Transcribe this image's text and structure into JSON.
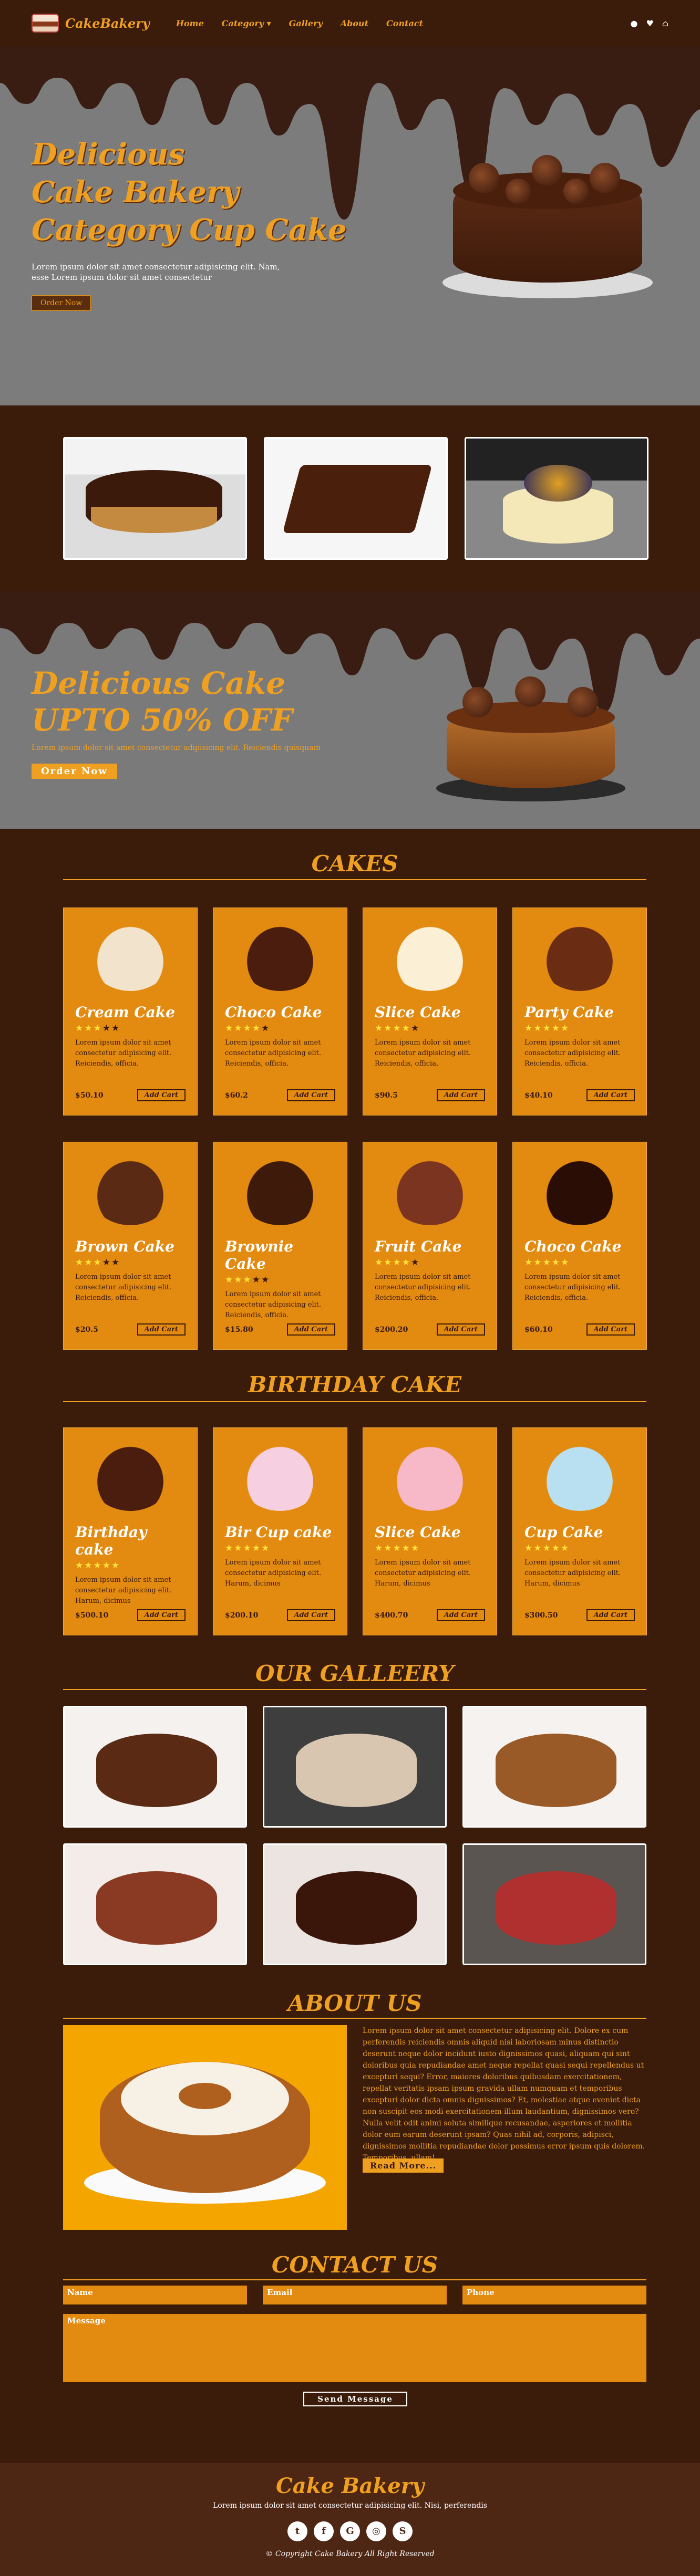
{
  "nav": {
    "logo": "CakeBakery",
    "items": [
      "Home",
      "Category",
      "Gallery",
      "About",
      "Contact"
    ],
    "category_caret": "▾",
    "icons": [
      "user-icon",
      "heart-icon",
      "cart-icon"
    ]
  },
  "hero": {
    "line1": "Delicious",
    "line2": "Cake Bakery",
    "line3": "Category Cup Cake",
    "sub": "Lorem ipsum dolor sit amet consectetur adipisicing elit. Nam, esse Lorem ipsum dolor sit amet consectetur",
    "button": "Order Now"
  },
  "promo": {
    "title": "Delicious Cake",
    "offer": "UPTO 50% OFF",
    "sub": "Lorem ipsum dolor sit amet consectetur adipisicing elit. Reiciendis quisquam",
    "button": "Order Now"
  },
  "cakes": {
    "title": "CAKES",
    "items": [
      {
        "name": "Cream Cake",
        "stars": 3,
        "desc": "Lorem ipsum dolor sit amet consectetur adipisicing elit. Reiciendis, officia.",
        "price": "$50.10",
        "color": "#f2e4cc"
      },
      {
        "name": "Choco Cake",
        "stars": 4,
        "desc": "Lorem ipsum dolor sit amet consectetur adipisicing elit. Reiciendis, officia.",
        "price": "$60.2",
        "color": "#4a1d0e"
      },
      {
        "name": "Slice Cake",
        "stars": 4,
        "desc": "Lorem ipsum dolor sit amet consectetur adipisicing elit. Reiciendis, officia.",
        "price": "$90.5",
        "color": "#fbefd6"
      },
      {
        "name": "Party Cake",
        "stars": 5,
        "desc": "Lorem ipsum dolor sit amet consectetur adipisicing elit. Reiciendis, officia.",
        "price": "$40.10",
        "color": "#6a2c12"
      },
      {
        "name": "Brown Cake",
        "stars": 3,
        "desc": "Lorem ipsum dolor sit amet consectetur adipisicing elit. Reiciendis, officia.",
        "price": "$20.5",
        "color": "#5a2a14"
      },
      {
        "name": "Brownie Cake",
        "stars": 3,
        "desc": "Lorem ipsum dolor sit amet consectetur adipisicing elit. Reiciendis, officia.",
        "price": "$15.80",
        "color": "#3e1a0a"
      },
      {
        "name": "Fruit Cake",
        "stars": 4,
        "desc": "Lorem ipsum dolor sit amet consectetur adipisicing elit. Reiciendis, officia.",
        "price": "$200.20",
        "color": "#7a3420"
      },
      {
        "name": "Choco Cake",
        "stars": 5,
        "desc": "Lorem ipsum dolor sit amet consectetur adipisicing elit. Reiciendis, officia.",
        "price": "$60.10",
        "color": "#2a0e06"
      }
    ],
    "add_cart": "Add Cart"
  },
  "birthday": {
    "title": "BIRTHDAY CAKE",
    "items": [
      {
        "name": "Birthday cake",
        "stars": 5,
        "desc": "Lorem ipsum dolor sit amet consectetur adipisicing elit. Harum, dicimus",
        "price": "$500.10",
        "color": "#4a1d0e"
      },
      {
        "name": "Bir Cup cake",
        "stars": 5,
        "desc": "Lorem ipsum dolor sit amet consectetur adipisicing elit. Harum, dicimus",
        "price": "$200.10",
        "color": "#f6d0e0"
      },
      {
        "name": "Slice Cake",
        "stars": 5,
        "desc": "Lorem ipsum dolor sit amet consectetur adipisicing elit. Harum, dicimus",
        "price": "$400.70",
        "color": "#f7b8c8"
      },
      {
        "name": "Cup Cake",
        "stars": 5,
        "desc": "Lorem ipsum dolor sit amet consectetur adipisicing elit. Harum, dicimus",
        "price": "$300.50",
        "color": "#b8e0f0"
      }
    ],
    "add_cart": "Add Cart"
  },
  "gallery": {
    "title": "OUR GALLEERY",
    "items": [
      {
        "name": "gallery-donuts",
        "bg": "#f4f1ee",
        "fg": "#5a2a14"
      },
      {
        "name": "gallery-dessert-cups",
        "bg": "#3e3e3e",
        "fg": "#d8c6b0"
      },
      {
        "name": "gallery-muffins",
        "bg": "#f5f2ef",
        "fg": "#9a5a28"
      },
      {
        "name": "gallery-berry-cake",
        "bg": "#f3ece8",
        "fg": "#8a3a22"
      },
      {
        "name": "gallery-chocolate-bundt",
        "bg": "#ece4e0",
        "fg": "#3a150a"
      },
      {
        "name": "gallery-red-velvet-slice",
        "bg": "#5a5550",
        "fg": "#b03030"
      }
    ]
  },
  "about": {
    "title": "ABOUT US",
    "text": "Lorem ipsum dolor sit amet consectetur adipisicing elit. Dolore ex cum perferendis reiciendis omnis aliquid nisi laboriosam minus distinctio deserunt neque dolor incidunt iusto dignissimos quasi, aliquam qui sint doloribus quia repudiandae amet neque repellat quasi sequi repellendus ut excepturi sequi? Error, maiores doloribus quibusdam exercitationem, repellat veritatis ipsam ipsum gravida ullam numquam et temporibus excepturi dolor dicta omnis dignissimos? Et, molestiae atque eveniet dicta non suscipit eos modi exercitationem illum laudantium, dignissimos vero? Nulla velit odit animi soluta similique recusandae, asperiores et mollitia dolor eum earum deserunt ipsam? Quas nihil ad, corporis, adipisci, dignissimos mollitia repudiandae dolor possimus error ipsum quis dolorem. Temporibus, ullam!",
    "button": "Read More..."
  },
  "contact": {
    "title": "CONTACT US",
    "name": "Name",
    "email": "Email",
    "phone": "Phone",
    "message": "Message",
    "send": "Send Message"
  },
  "footer": {
    "title": "Cake Bakery",
    "sub": "Lorem ipsum dolor sit amet consectetur adipisicing elit. Nisi, perferendis",
    "socials": [
      "twitter-icon",
      "facebook-icon",
      "google-icon",
      "instagram-icon",
      "skype-icon"
    ],
    "social_glyphs": [
      "t",
      "f",
      "G",
      "◎",
      "S"
    ],
    "copyright": "© Copyright Cake Bakery All Right Reserved"
  }
}
